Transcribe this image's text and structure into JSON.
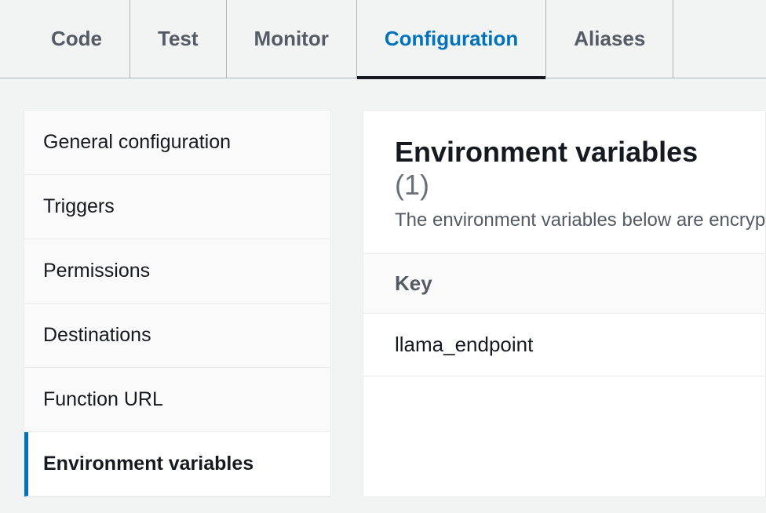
{
  "tabs": [
    {
      "label": "Code",
      "active": false
    },
    {
      "label": "Test",
      "active": false
    },
    {
      "label": "Monitor",
      "active": false
    },
    {
      "label": "Configuration",
      "active": true
    },
    {
      "label": "Aliases",
      "active": false
    }
  ],
  "sidebar": {
    "items": [
      {
        "label": "General configuration",
        "active": false
      },
      {
        "label": "Triggers",
        "active": false
      },
      {
        "label": "Permissions",
        "active": false
      },
      {
        "label": "Destinations",
        "active": false
      },
      {
        "label": "Function URL",
        "active": false
      },
      {
        "label": "Environment variables",
        "active": true
      }
    ]
  },
  "panel": {
    "title": "Environment variables",
    "count": "(1)",
    "subtitle": "The environment variables below are encryp",
    "key_header": "Key",
    "rows": [
      {
        "key": "llama_endpoint"
      }
    ]
  }
}
